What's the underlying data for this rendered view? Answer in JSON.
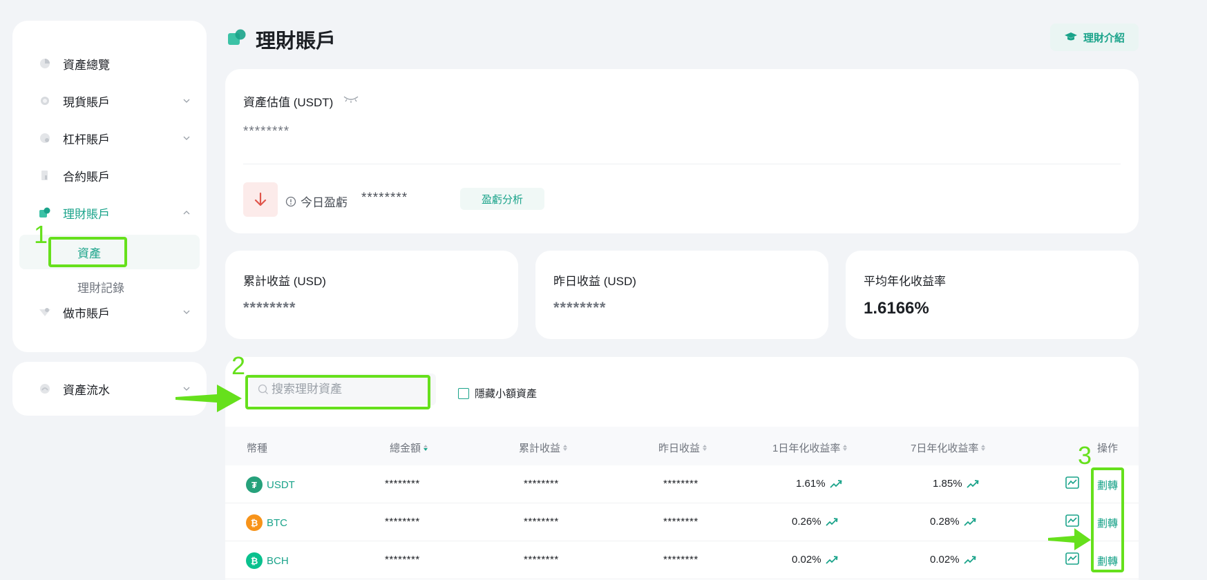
{
  "sidebar": {
    "items": [
      {
        "label": "資產總覽"
      },
      {
        "label": "現貨賬戶"
      },
      {
        "label": "杠杆賬戶"
      },
      {
        "label": "合約賬戶"
      },
      {
        "label": "理財賬戶"
      },
      {
        "label": "做市賬戶"
      }
    ],
    "sub_items": [
      {
        "label": "資產"
      },
      {
        "label": "理財記錄"
      }
    ],
    "flow": {
      "label": "資產流水"
    }
  },
  "annotations": [
    "1",
    "2",
    "3"
  ],
  "header": {
    "title": "理財賬戶",
    "intro_button": "理財介紹"
  },
  "valuation": {
    "title": "資產估值 (USDT)",
    "value": "********",
    "today_pnl_label": "今日盈虧",
    "today_pnl_value": "********",
    "analysis_button": "盈虧分析"
  },
  "stats": [
    {
      "label": "累計收益 (USD)",
      "value": "********"
    },
    {
      "label": "昨日收益 (USD)",
      "value": "********"
    },
    {
      "label": "平均年化收益率",
      "value": "1.6166%"
    }
  ],
  "table": {
    "search_placeholder": "搜索理財資產",
    "hide_small_label": "隱藏小額資產",
    "headers": [
      "幣種",
      "總金額",
      "累計收益",
      "昨日收益",
      "1日年化收益率",
      "7日年化收益率",
      "操作"
    ],
    "rows": [
      {
        "coin": "USDT",
        "total": "********",
        "cumulative": "********",
        "yesterday": "********",
        "apy1": "1.61%",
        "apy7": "1.85%",
        "action": "劃轉"
      },
      {
        "coin": "BTC",
        "total": "********",
        "cumulative": "********",
        "yesterday": "********",
        "apy1": "0.26%",
        "apy7": "0.28%",
        "action": "劃轉"
      },
      {
        "coin": "BCH",
        "total": "********",
        "cumulative": "********",
        "yesterday": "********",
        "apy1": "0.02%",
        "apy7": "0.02%",
        "action": "劃轉"
      }
    ]
  },
  "colors": {
    "accent": "#1aa38a",
    "annotation": "#66e01c",
    "usdt": "#26a17b",
    "btc": "#f7931a",
    "bch": "#0ac18e"
  }
}
